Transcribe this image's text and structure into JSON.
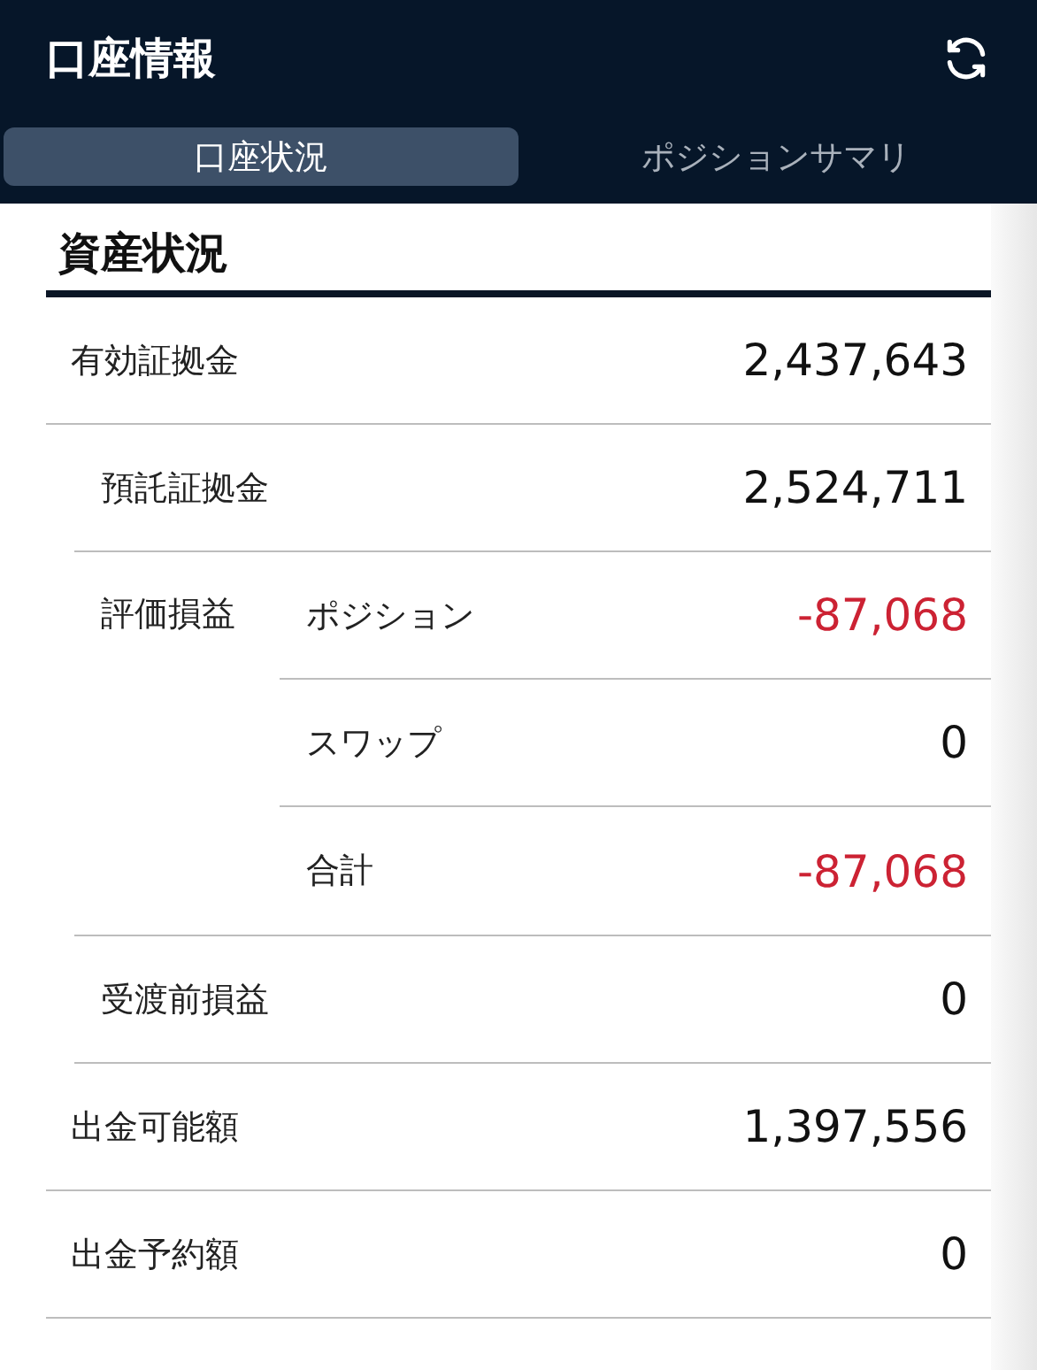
{
  "header": {
    "title": "口座情報"
  },
  "tabs": [
    {
      "label": "口座状況",
      "selected": true
    },
    {
      "label": "ポジションサマリ",
      "selected": false
    }
  ],
  "section": {
    "title": "資産状況"
  },
  "rows": [
    {
      "label": "有効証拠金",
      "value": "2,437,643",
      "negative": false,
      "children": [
        {
          "label": "預託証拠金",
          "value": "2,524,711",
          "negative": false
        },
        {
          "label": "評価損益",
          "children": [
            {
              "label": "ポジション",
              "value": "-87,068",
              "negative": true
            },
            {
              "label": "スワップ",
              "value": "0",
              "negative": false
            },
            {
              "label": "合計",
              "value": "-87,068",
              "negative": true
            }
          ]
        },
        {
          "label": "受渡前損益",
          "value": "0",
          "negative": false
        }
      ]
    },
    {
      "label": "出金可能額",
      "value": "1,397,556",
      "negative": false
    },
    {
      "label": "出金予約額",
      "value": "0",
      "negative": false
    }
  ]
}
